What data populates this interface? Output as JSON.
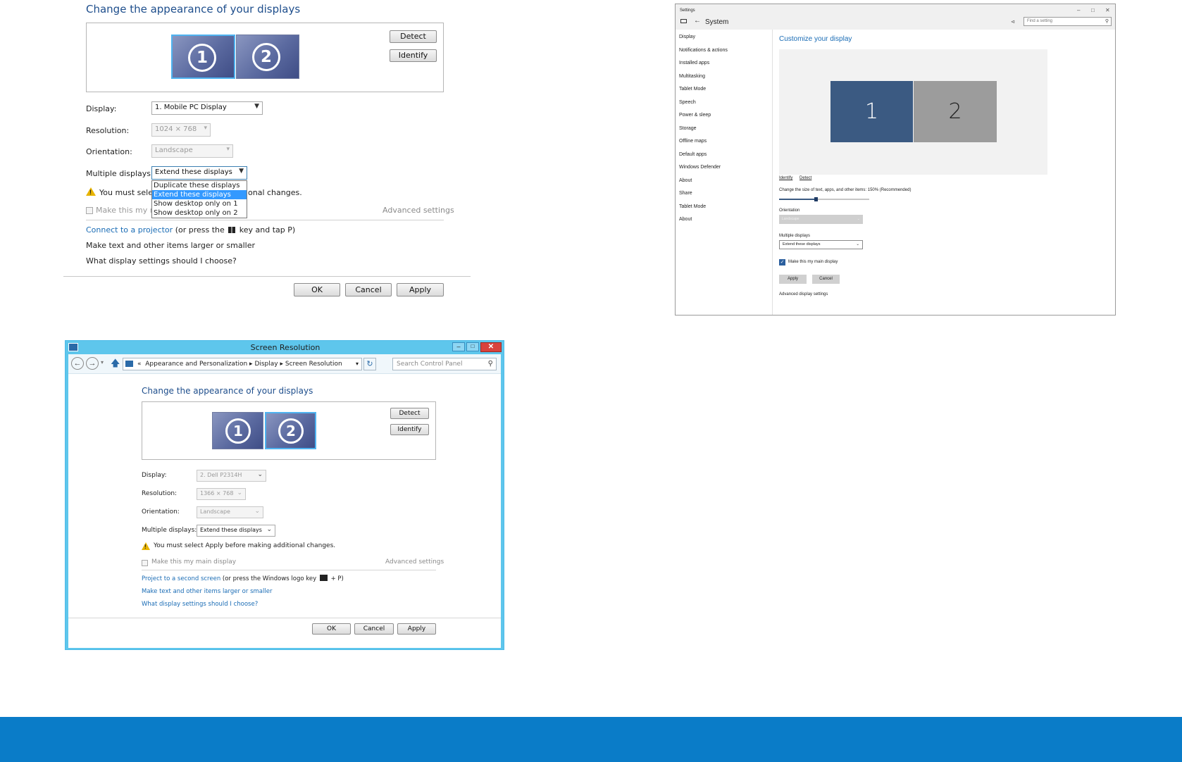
{
  "panel_a": {
    "heading": "Change the appearance of your displays",
    "monitor1": "1",
    "monitor2": "2",
    "detect": "Detect",
    "identify": "Identify",
    "display_label": "Display:",
    "display_value": "1. Mobile PC Display",
    "resolution_label": "Resolution:",
    "resolution_value": "1024 × 768",
    "orientation_label": "Orientation:",
    "orientation_value": "Landscape",
    "multiple_label": "Multiple displays:",
    "multiple_value": "Extend these displays",
    "dropdown_options": [
      "Duplicate these displays",
      "Extend these displays",
      "Show desktop only on 1",
      "Show desktop only on 2"
    ],
    "warning_part1": "You must selec",
    "warning_part2": "onal changes.",
    "main_display_partial": "Make this my m",
    "advanced": "Advanced settings",
    "connect_link": "Connect to a projector",
    "connect_hint_a": "(or press the",
    "connect_hint_b": "key and tap P)",
    "text_link": "Make text and other items larger or smaller",
    "choose_link": "What display settings should I choose?",
    "ok": "OK",
    "cancel": "Cancel",
    "apply": "Apply"
  },
  "panel_b": {
    "window_title": "Screen Resolution",
    "breadcrumb_sep": "«",
    "crumbs": [
      "Appearance and Personalization",
      "Display",
      "Screen Resolution"
    ],
    "search_placeholder": "Search Control Panel",
    "heading": "Change the appearance of your displays",
    "monitor1": "1",
    "monitor2": "2",
    "detect": "Detect",
    "identify": "Identify",
    "display_label": "Display:",
    "display_value": "2. Dell P2314H",
    "resolution_label": "Resolution:",
    "resolution_value": "1366 × 768",
    "orientation_label": "Orientation:",
    "orientation_value": "Landscape",
    "multiple_label": "Multiple displays:",
    "multiple_value": "Extend these displays",
    "warning": "You must select Apply before making additional changes.",
    "main_display": "Make this my main display",
    "advanced": "Advanced settings",
    "project_link": "Project to a second screen",
    "project_hint_a": "(or press the Windows logo key",
    "project_hint_b": "+ P)",
    "text_link": "Make text and other items larger or smaller",
    "choose_link": "What display settings should I choose?",
    "ok": "OK",
    "cancel": "Cancel",
    "apply": "Apply"
  },
  "panel_c": {
    "app_title": "Settings",
    "section": "System",
    "search_placeholder": "Find a setting",
    "nav": [
      "Display",
      "Notifications & actions",
      "Installed apps",
      "Multitasking",
      "Tablet Mode",
      "Speech",
      "Power & sleep",
      "Storage",
      "Offline maps",
      "Default apps",
      "Windows Defender",
      "About",
      "Share",
      "Tablet Mode",
      "About"
    ],
    "heading": "Customize your display",
    "monitor1": "1",
    "monitor2": "2",
    "identify": "Identify",
    "detect": "Detect",
    "scale_label": "Change the size of text, apps, and other items: 150% (Recommended)",
    "orientation_label": "Orientation",
    "orientation_value": "Landscape",
    "multiple_label": "Multiple displays",
    "multiple_value": "Extend these displays",
    "main_display": "Make this my main display",
    "apply": "Apply",
    "cancel": "Cancel",
    "advanced": "Advanced display settings"
  },
  "colors": {
    "footer_band": "#0a7cc8",
    "link": "#1a6cb5",
    "win8_titlebar": "#5ec6ec",
    "win10_tile1": "#3b5a82",
    "win10_tile2": "#9c9c9c",
    "close_button": "#d9423d"
  },
  "icons": [
    "warning-icon",
    "windows-key-icon",
    "back-arrow-icon",
    "forward-arrow-icon",
    "up-arrow-icon",
    "refresh-icon",
    "search-icon",
    "monitor-icon",
    "pin-icon"
  ]
}
